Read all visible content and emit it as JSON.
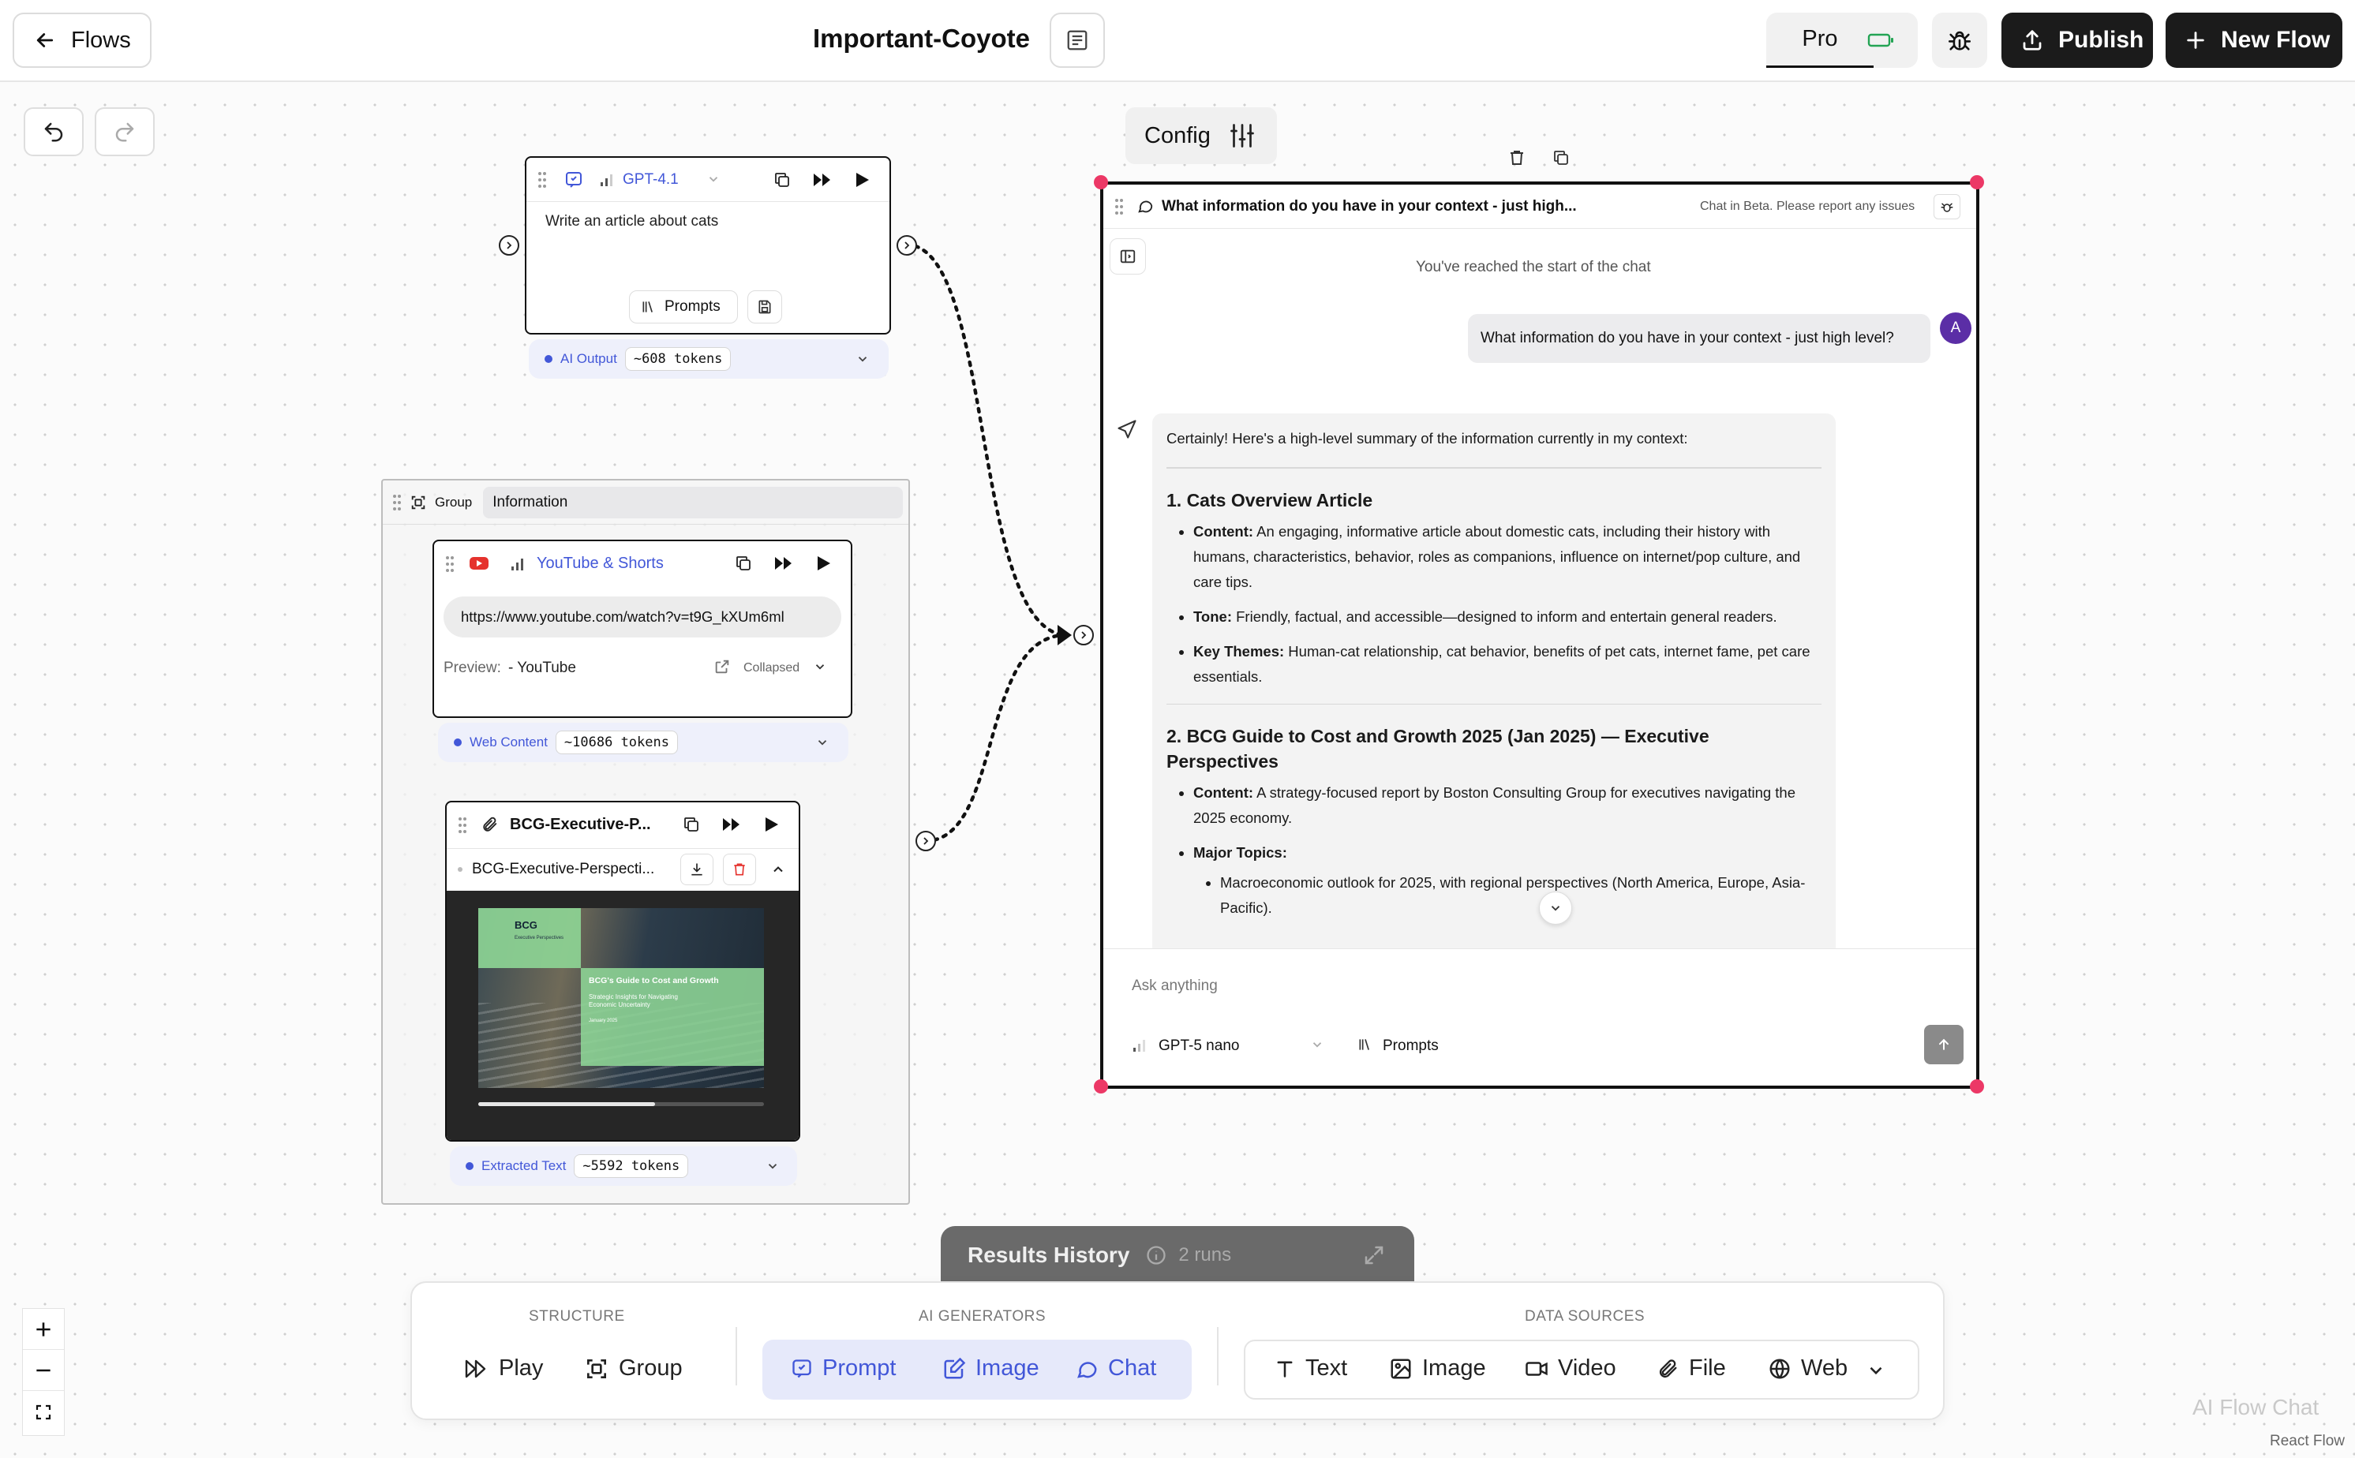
{
  "topbar": {
    "back_label": "Flows",
    "flow_title": "Important-Coyote",
    "pro_label": "Pro",
    "publish_label": "Publish",
    "new_flow_label": "New Flow"
  },
  "config": {
    "label": "Config"
  },
  "prompt_node": {
    "model": "GPT-4.1",
    "text": "Write an article about cats",
    "prompts_label": "Prompts",
    "output_label": "AI Output",
    "tokens": "~608 tokens"
  },
  "group": {
    "tag": "Group",
    "name": "Information"
  },
  "youtube_node": {
    "title": "YouTube & Shorts",
    "url": "https://www.youtube.com/watch?v=t9G_kXUm6ml",
    "preview_label": "Preview:",
    "preview_value": "- YouTube",
    "collapsed_label": "Collapsed",
    "output_label": "Web Content",
    "tokens": "~10686 tokens"
  },
  "file_node": {
    "title": "BCG-Executive-P...",
    "file_name": "BCG-Executive-Perspecti...",
    "thumb_logo": "BCG",
    "thumb_small": "Executive Perspectives",
    "thumb_heading": "BCG's Guide to Cost and Growth",
    "thumb_sub": "Strategic Insights for Navigating Economic Uncertainty",
    "thumb_date": "January 2025",
    "output_label": "Extracted Text",
    "tokens": "~5592 tokens",
    "scroll_progress": 0.62
  },
  "chat_node": {
    "title": "What information do you have in your context - just high...",
    "beta_note": "Chat in Beta. Please report any issues",
    "start_note": "You've reached the start of the chat",
    "user_message": "What information do you have in your context - just high level?",
    "user_avatar": "A",
    "reply_intro": "Certainly! Here's a high-level summary of the information currently in my context:",
    "s1_title": "1. Cats Overview Article",
    "s1_content_label": "Content:",
    "s1_content": "An engaging, informative article about domestic cats, including their history with humans, characteristics, behavior, roles as companions, influence on internet/pop culture, and care tips.",
    "s1_tone_label": "Tone:",
    "s1_tone": "Friendly, factual, and accessible—designed to inform and entertain general readers.",
    "s1_themes_label": "Key Themes:",
    "s1_themes": "Human-cat relationship, cat behavior, benefits of pet cats, internet fame, pet care essentials.",
    "s2_title": "2. BCG Guide to Cost and Growth 2025 (Jan 2025) — Executive Perspectives",
    "s2_content_label": "Content:",
    "s2_content": "A strategy-focused report by Boston Consulting Group for executives navigating the 2025 economy.",
    "s2_topics_label": "Major Topics:",
    "s2_topic1": "Macroeconomic outlook for 2025, with regional perspectives (North America, Europe, Asia-Pacific).",
    "input_placeholder": "Ask anything",
    "model": "GPT-5 nano",
    "prompts_label": "Prompts"
  },
  "results": {
    "label": "Results History",
    "runs": "2 runs"
  },
  "toolbar": {
    "structure_label": "STRUCTURE",
    "play": "Play",
    "group": "Group",
    "ai_label": "AI GENERATORS",
    "prompt": "Prompt",
    "image_ai": "Image",
    "chat": "Chat",
    "data_label": "DATA SOURCES",
    "text": "Text",
    "image": "Image",
    "video": "Video",
    "file": "File",
    "web": "Web"
  },
  "footer": {
    "ai_flow_chat": "AI Flow Chat",
    "react_flow": "React Flow"
  },
  "colors": {
    "accent_blue": "#4257d8",
    "handle_pink": "#ec3866",
    "avatar_purple": "#5b2ea6",
    "youtube_red": "#e5322d"
  }
}
